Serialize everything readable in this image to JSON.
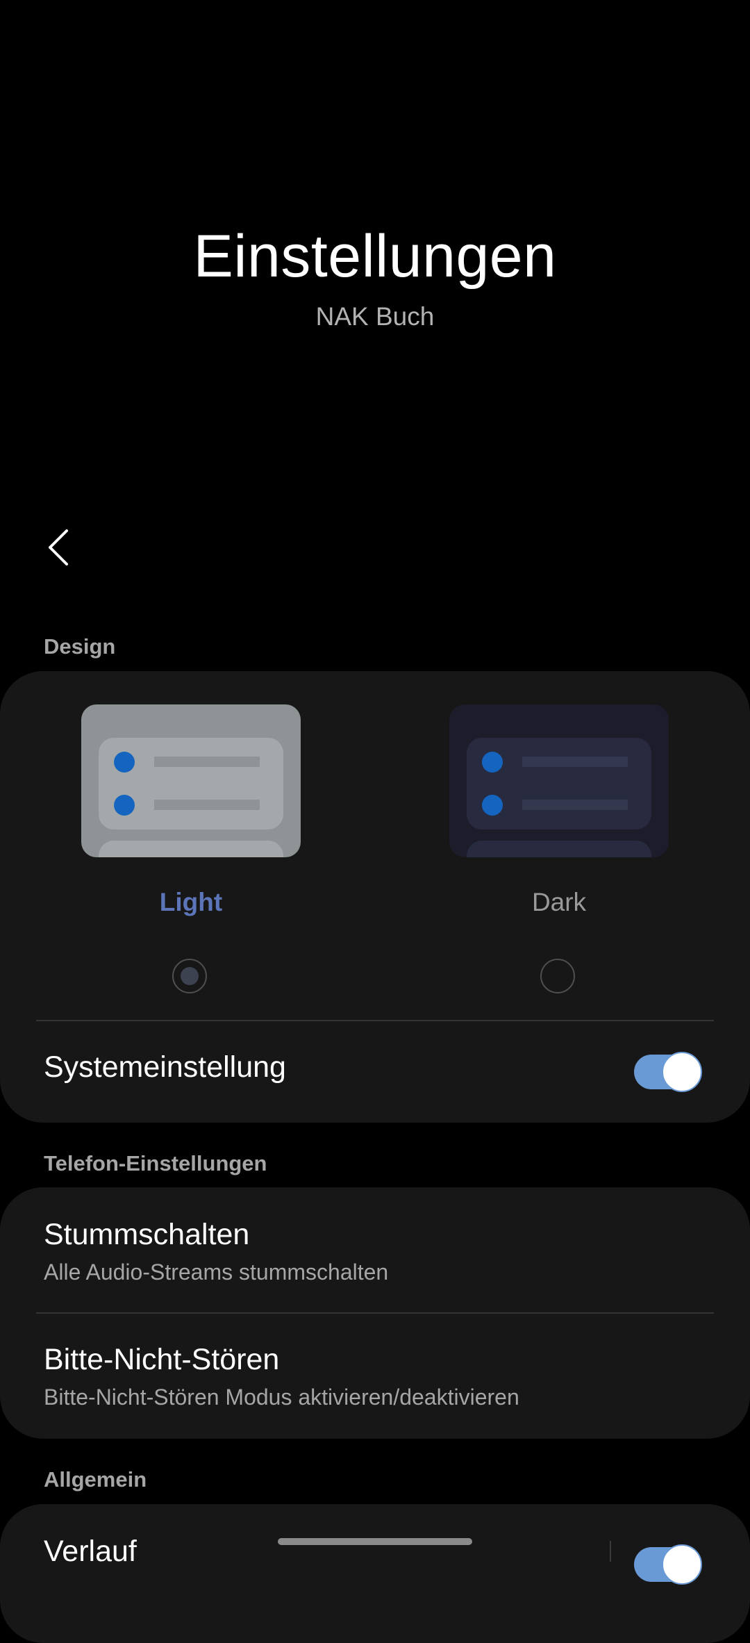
{
  "header": {
    "title": "Einstellungen",
    "subtitle": "NAK Buch"
  },
  "nav": {
    "back_icon": "chevron-left-icon"
  },
  "design": {
    "section_label": "Design",
    "themes": [
      {
        "label": "Light",
        "selected": true,
        "label_color": "#5c74b8"
      },
      {
        "label": "Dark",
        "selected": false,
        "label_color": "#9a9a9a"
      }
    ],
    "system_setting": {
      "label": "Systemeinstellung",
      "enabled": true
    }
  },
  "phone_settings": {
    "section_label": "Telefon-Einstellungen",
    "items": [
      {
        "title": "Stummschalten",
        "subtitle": "Alle Audio-Streams stummschalten"
      },
      {
        "title": "Bitte-Nicht-Stören",
        "subtitle": "Bitte-Nicht-Stören Modus aktivieren/deaktivieren"
      }
    ]
  },
  "general": {
    "section_label": "Allgemein",
    "items": [
      {
        "title": "Verlauf",
        "enabled": true
      }
    ]
  },
  "colors": {
    "accent": "#6a9ad5",
    "background": "#000000",
    "card": "#171717"
  }
}
